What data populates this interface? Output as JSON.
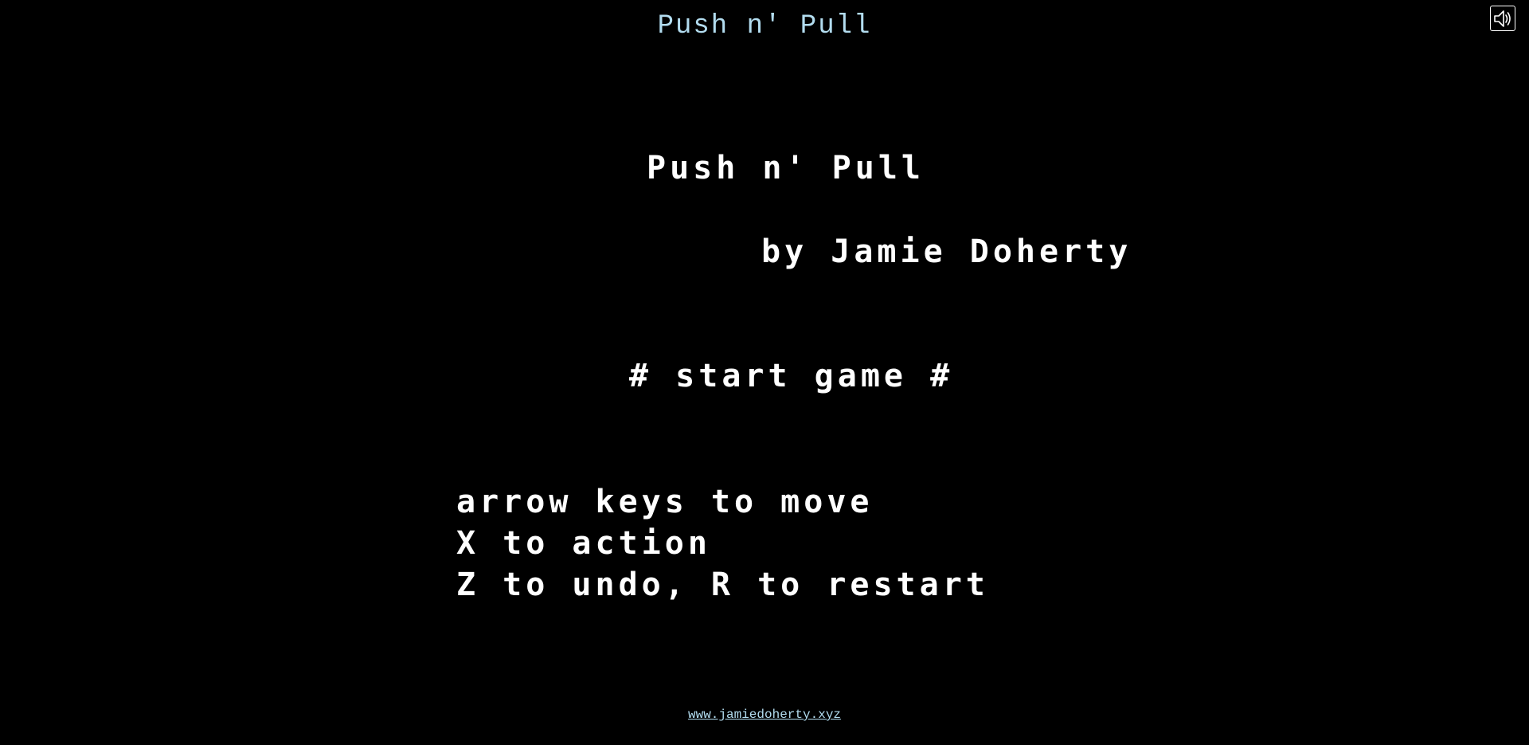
{
  "header": {
    "title": "Push n' Pull",
    "title_color": "#b2dcef",
    "mute_icon": "speaker-icon"
  },
  "game": {
    "title": "Push n' Pull",
    "author": "by Jamie Doherty",
    "start_option": "# start game #",
    "instructions": [
      "arrow keys to move",
      "X to action",
      "Z to undo, R to restart"
    ],
    "text_color": "#ffffff",
    "background_color": "#000000"
  },
  "footer": {
    "link_text": "www.jamiedoherty.xyz",
    "link_color": "#b2dcef"
  }
}
